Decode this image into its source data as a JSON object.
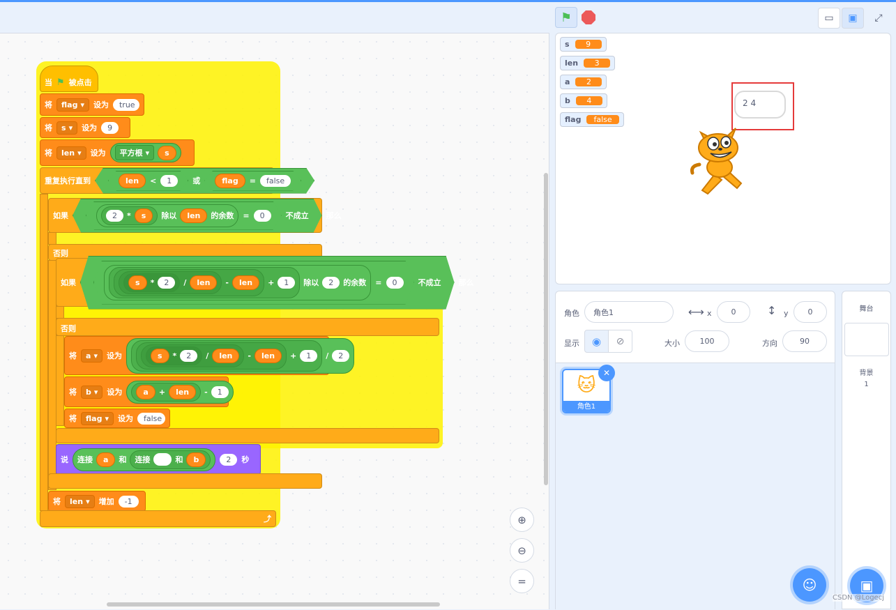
{
  "toolbar": {
    "green_flag": "green-flag",
    "stop": "stop-sign"
  },
  "code": {
    "hat": {
      "when": "当",
      "clicked": "被点击"
    },
    "set": "将",
    "to": "设为",
    "set_flag": {
      "var": "flag",
      "value": "true"
    },
    "set_s": {
      "var": "s",
      "value": "9"
    },
    "set_len": {
      "var": "len",
      "func": "平方根",
      "arg": "s"
    },
    "repeat_until": {
      "label": "重复执行直到",
      "lhs": "len",
      "op": "<",
      "rhs": "1",
      "or": "或",
      "lhs2": "flag",
      "eq": "=",
      "rhs2": "false"
    },
    "if1": {
      "if": "如果",
      "a": "2",
      "times": "*",
      "b": "s",
      "mod": "除以",
      "c": "len",
      "rem": "的余数",
      "eq": "=",
      "d": "0",
      "not": "不成立",
      "then": "那么"
    },
    "else": "否则",
    "if2": {
      "if": "如果",
      "a": "s",
      "times": "*",
      "b": "2",
      "div": "/",
      "c": "len",
      "minus": "-",
      "d": "len",
      "plus": "+",
      "e": "1",
      "mod": "除以",
      "f": "2",
      "rem": "的余数",
      "eq": "=",
      "g": "0",
      "not": "不成立",
      "then": "那么"
    },
    "set_a": {
      "var": "a",
      "r1": "s",
      "t": "*",
      "r2": "2",
      "d": "/",
      "r3": "len",
      "m": "-",
      "r4": "len",
      "p": "+",
      "r5": "1",
      "d2": "/",
      "r6": "2"
    },
    "set_b": {
      "var": "b",
      "r1": "a",
      "p": "+",
      "r2": "len",
      "m": "-",
      "r3": "1"
    },
    "set_flag2": {
      "var": "flag",
      "value": "false"
    },
    "say": {
      "label": "说",
      "join": "连接",
      "a": "a",
      "and": "和",
      "join2": "连接",
      "empty": "",
      "and2": "和",
      "b": "b",
      "secs": "2",
      "sec_label": "秒"
    },
    "change": {
      "label": "将",
      "var": "len",
      "by": "增加",
      "value": "-1"
    }
  },
  "monitors": [
    {
      "name": "s",
      "value": "9"
    },
    {
      "name": "len",
      "value": "3"
    },
    {
      "name": "a",
      "value": "2"
    },
    {
      "name": "b",
      "value": "4"
    },
    {
      "name": "flag",
      "value": "false"
    }
  ],
  "bubble": "2 4",
  "sprite_info": {
    "sprite_label": "角色",
    "sprite_name": "角色1",
    "x_label": "x",
    "x": "0",
    "y_label": "y",
    "y": "0",
    "show_label": "显示",
    "size_label": "大小",
    "size": "100",
    "direction_label": "方向",
    "direction": "90"
  },
  "sprites": [
    {
      "name": "角色1"
    }
  ],
  "stage_panel": {
    "title": "舞台",
    "backdrops_label": "背景",
    "backdrops_count": "1"
  },
  "watermark": "CSDN @Logecj",
  "colors": {
    "accent": "#4c97ff",
    "events": "#ffbf00",
    "control": "#ffab19",
    "variables": "#ff8c1a",
    "operators": "#59c059",
    "looks": "#9966ff",
    "highlight": "#fff200"
  }
}
